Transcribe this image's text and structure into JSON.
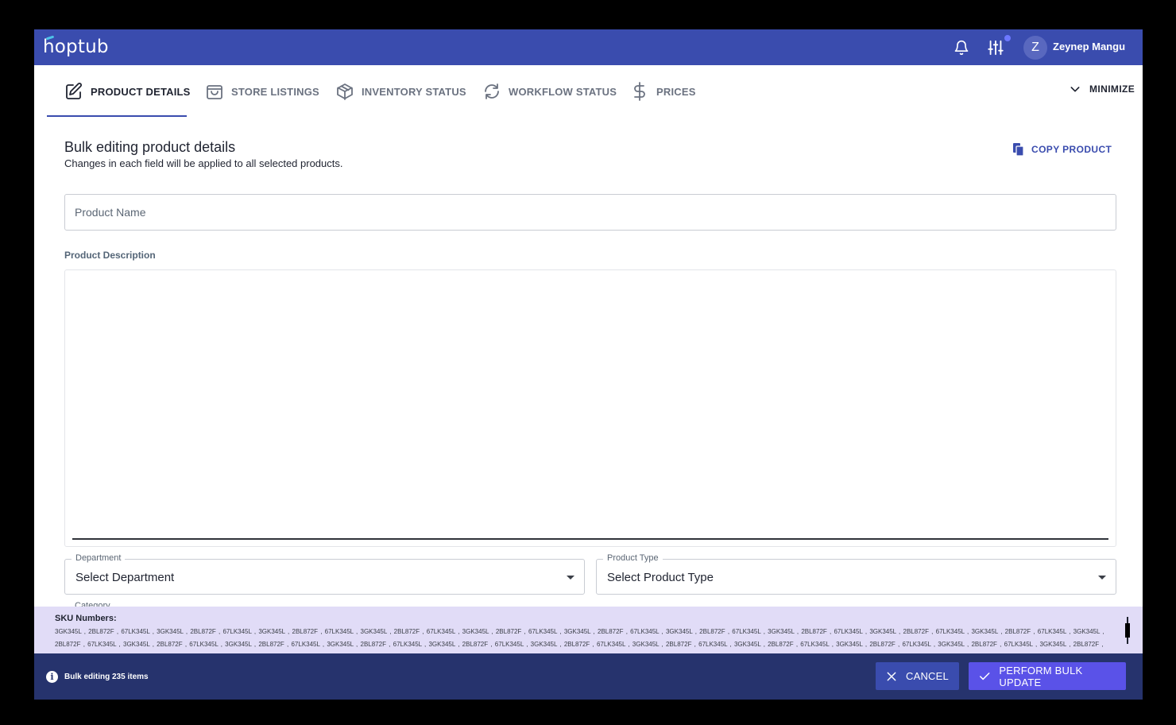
{
  "app": {
    "logo": "hoptub",
    "user_initial": "Z",
    "user_name": "Zeynep Mangu"
  },
  "tabs": [
    {
      "label": "PRODUCT DETAILS",
      "icon": "edit-icon",
      "active": true
    },
    {
      "label": "STORE LISTINGS",
      "icon": "shopping-bag-icon",
      "active": false
    },
    {
      "label": "INVENTORY STATUS",
      "icon": "box-icon",
      "active": false
    },
    {
      "label": "WORKFLOW STATUS",
      "icon": "refresh-icon",
      "active": false
    },
    {
      "label": "PRICES",
      "icon": "dollar-icon",
      "active": false
    }
  ],
  "minimize_label": "MINIMIZE",
  "form": {
    "title": "Bulk editing product details",
    "subtitle": "Changes in each field will be applied to all selected products.",
    "copy_label": "COPY PRODUCT",
    "product_name_placeholder": "Product Name",
    "description_label": "Product Description",
    "department_label": "Department",
    "department_value": "Select Department",
    "product_type_label": "Product Type",
    "product_type_value": "Select Product Type",
    "category_label": "Category"
  },
  "sku": {
    "title": "SKU Numbers:",
    "line1": "3GK345L , 2BL872F , 67LK345L , 3GK345L , 2BL872F , 67LK345L , 3GK345L , 2BL872F , 67LK345L , 3GK345L , 2BL872F , 67LK345L , 3GK345L , 2BL872F , 67LK345L , 3GK345L , 2BL872F , 67LK345L , 3GK345L , 2BL872F , 67LK345L , 3GK345L , 2BL872F , 67LK345L , 3GK345L , 2BL872F , 67LK345L , 3GK345L , 2BL872F , 67LK345L , 3GK345L ,",
    "line2": "2BL872F , 67LK345L , 3GK345L , 2BL872F , 67LK345L , 3GK345L , 2BL872F , 67LK345L , 3GK345L , 2BL872F , 67LK345L , 3GK345L , 2BL872F , 67LK345L , 3GK345L , 2BL872F , 67LK345L , 3GK345L , 2BL872F , 67LK345L , 3GK345L , 2BL872F , 67LK345L , 3GK345L , 2BL872F , 67LK345L , 3GK345L , 2BL872F , 67LK345L , 3GK345L , 2BL872F ,"
  },
  "footer": {
    "info_text": "Bulk editing 235 items",
    "cancel_label": "CANCEL",
    "perform_label": "PERFORM BULK UPDATE"
  },
  "colors": {
    "primary": "#3a4cae",
    "footer": "#26336d",
    "accent": "#5a52e8",
    "sku_bg": "#e1dcf7"
  }
}
